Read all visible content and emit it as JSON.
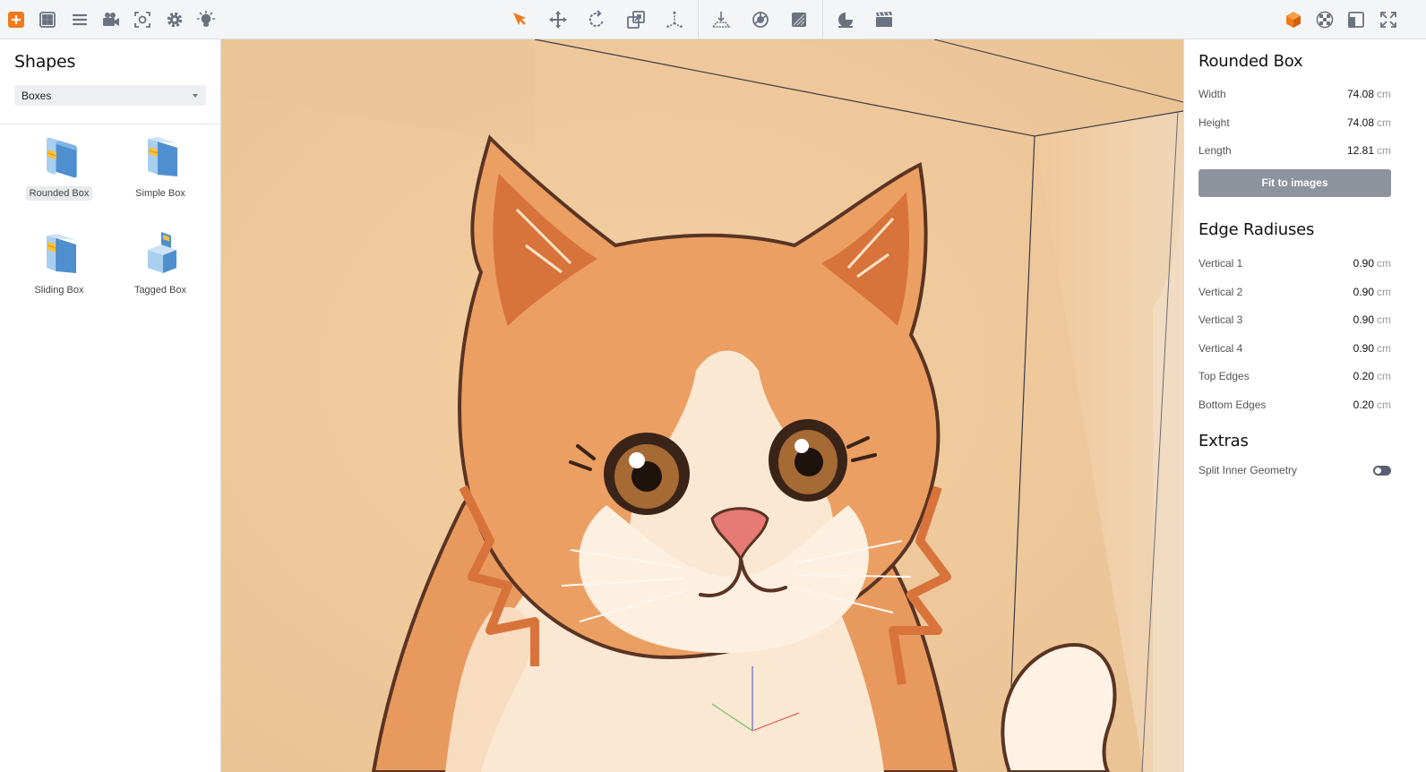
{
  "colors": {
    "accent": "#f07a1a",
    "icon": "#6b7280",
    "button": "#8d939d"
  },
  "toolbar": {
    "left_icons": [
      "add-icon",
      "grid-icon",
      "list-icon",
      "camera-icon",
      "focus-icon",
      "gear-icon",
      "light-icon"
    ],
    "center_icons": [
      "select-arrow-icon",
      "move-icon",
      "rotate-icon",
      "scale-icon",
      "axes-icon",
      "align-floor-icon",
      "texture-icon",
      "shading-icon",
      "environment-icon",
      "clapperboard-icon"
    ],
    "right_icons": [
      "cube-icon",
      "checker-icon",
      "panels-icon",
      "fullscreen-icon"
    ]
  },
  "shapes": {
    "title": "Shapes",
    "category": "Boxes",
    "items": [
      {
        "label": "Rounded Box",
        "icon": "rounded-box-icon"
      },
      {
        "label": "Simple Box",
        "icon": "simple-box-icon"
      },
      {
        "label": "Sliding Box",
        "icon": "sliding-box-icon"
      },
      {
        "label": "Tagged Box",
        "icon": "tagged-box-icon"
      }
    ]
  },
  "properties": {
    "title": "Rounded Box",
    "dimensions": [
      {
        "label": "Width",
        "value": "74.08",
        "unit": "cm"
      },
      {
        "label": "Height",
        "value": "74.08",
        "unit": "cm"
      },
      {
        "label": "Length",
        "value": "12.81",
        "unit": "cm"
      }
    ],
    "fit_label": "Fit to images",
    "edge_title": "Edge Radiuses",
    "edges": [
      {
        "label": "Vertical 1",
        "value": "0.90",
        "unit": "cm"
      },
      {
        "label": "Vertical 2",
        "value": "0.90",
        "unit": "cm"
      },
      {
        "label": "Vertical 3",
        "value": "0.90",
        "unit": "cm"
      },
      {
        "label": "Vertical 4",
        "value": "0.90",
        "unit": "cm"
      },
      {
        "label": "Top Edges",
        "value": "0.20",
        "unit": "cm"
      },
      {
        "label": "Bottom Edges",
        "value": "0.20",
        "unit": "cm"
      }
    ],
    "extras_title": "Extras",
    "split_label": "Split Inner Geometry"
  }
}
